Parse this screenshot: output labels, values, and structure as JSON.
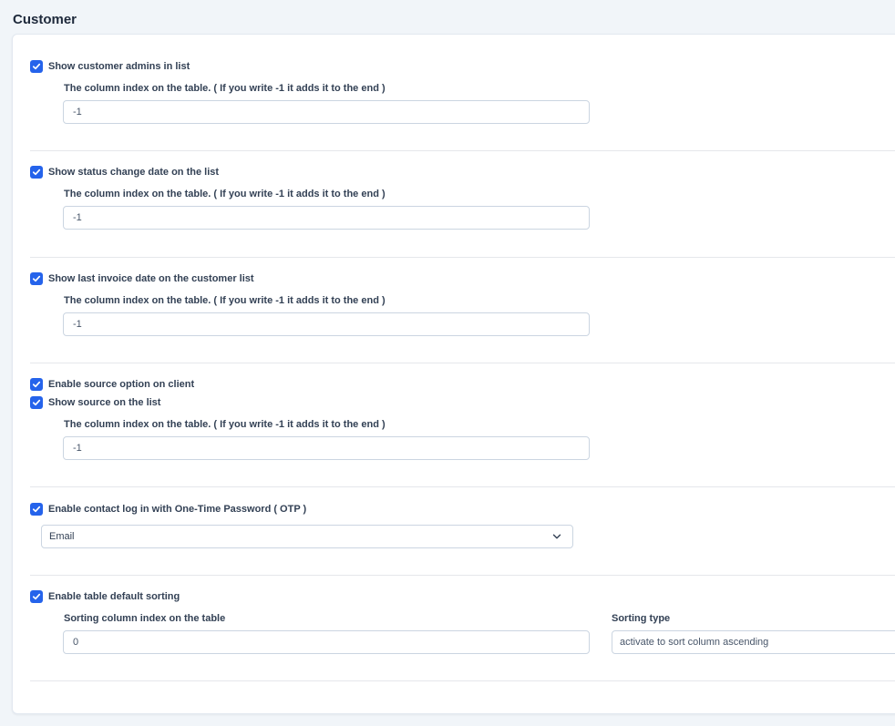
{
  "page": {
    "title": "Customer"
  },
  "colors": {
    "accent": "#2563eb",
    "border": "#cbd5e1",
    "background": "#f1f5f9"
  },
  "sections": {
    "admins": {
      "checkbox_label": "Show customer admins in list",
      "checked": true,
      "index_label": "The column index on the table. ( If you write -1 it adds it to the end )",
      "index_value": "-1"
    },
    "status_change": {
      "checkbox_label": "Show status change date on the list",
      "checked": true,
      "index_label": "The column index on the table. ( If you write -1 it adds it to the end )",
      "index_value": "-1"
    },
    "last_invoice": {
      "checkbox_label": "Show last invoice date on the customer list",
      "checked": true,
      "index_label": "The column index on the table. ( If you write -1 it adds it to the end )",
      "index_value": "-1"
    },
    "source": {
      "enable_label": "Enable source option on client",
      "enable_checked": true,
      "show_label": "Show source on the list",
      "show_checked": true,
      "index_label": "The column index on the table. ( If you write -1 it adds it to the end )",
      "index_value": "-1"
    },
    "otp": {
      "checkbox_label": "Enable contact log in with One-Time Password ( OTP )",
      "checked": true,
      "method_value": "Email",
      "method_icon": "chevron-down-icon"
    },
    "sorting": {
      "checkbox_label": "Enable table default sorting",
      "checked": true,
      "column_label": "Sorting column index on the table",
      "column_value": "0",
      "type_label": "Sorting type",
      "type_value": "activate to sort column ascending"
    }
  }
}
